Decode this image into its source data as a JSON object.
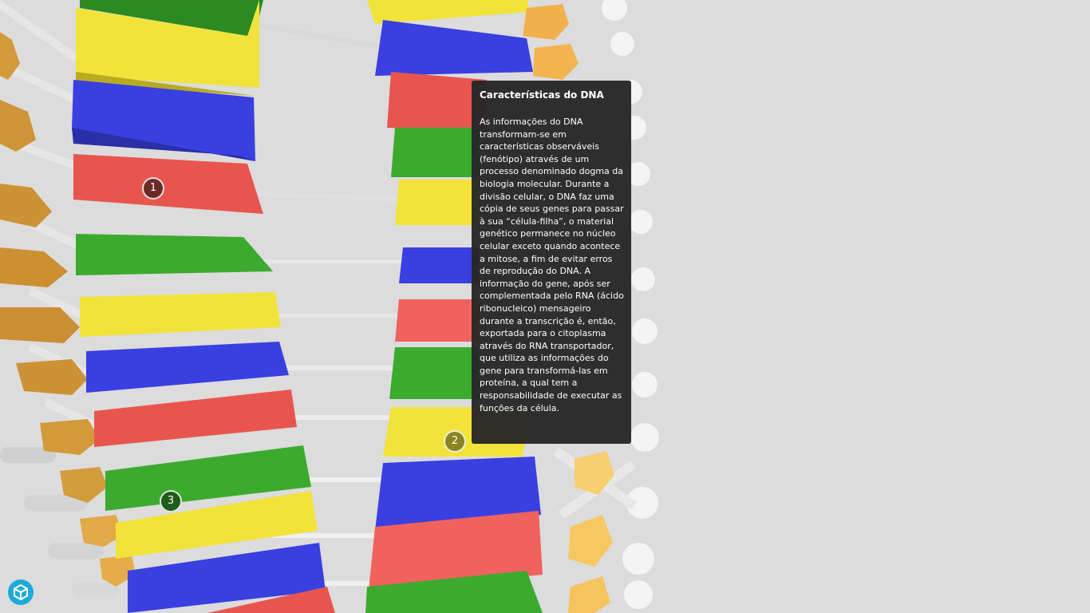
{
  "viewer": {
    "logo_icon": "cube-icon",
    "accent": "#1caad9"
  },
  "hotspots": [
    {
      "label": "1"
    },
    {
      "label": "2"
    },
    {
      "label": "3"
    }
  ],
  "annotation": {
    "title": "Características do DNA",
    "body": "As informações do DNA transformam-se em características observáveis (fenótipo) através de um processo denominado dogma da biologia molecular. Durante a divisão celular, o DNA faz uma cópia de seus genes para passar à sua “célula-filha”, o material genético permanece no núcleo celular exceto quando acontece a mitose, a fim de evitar erros de reprodução do DNA. A informação do gene, após ser complementada pelo RNA (ácido ribonucleico) mensageiro durante a transcrição é, então, exportada para o citoplasma através do RNA transportador, que utiliza as informações do gene para transformá-las em proteína, a qual tem a responsabilidade de executar as funções da célula."
  },
  "colors": {
    "base_yellow": "#f2e33a",
    "base_blue": "#3a3fe0",
    "base_red": "#e8554f",
    "base_green": "#3caa2e",
    "phosphate_orange": "#f0b04a",
    "backbone_white": "#f2f2f2",
    "background": "#dcdcdc"
  }
}
